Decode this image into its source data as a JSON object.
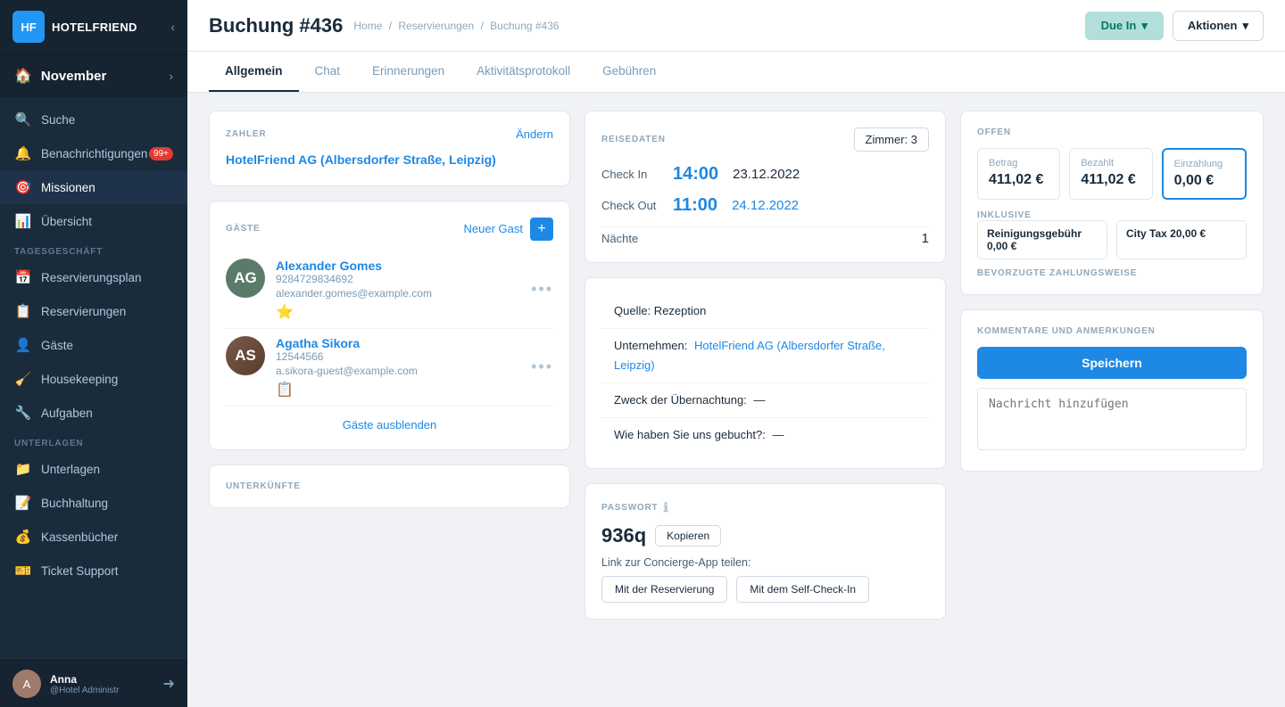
{
  "sidebar": {
    "logo_text": "HOTELFRIEND",
    "month": "November",
    "nav_items": [
      {
        "id": "suche",
        "label": "Suche",
        "icon": "🔍"
      },
      {
        "id": "benachrichtigungen",
        "label": "Benachrichtigungen",
        "icon": "🔔",
        "badge": "99+"
      },
      {
        "id": "missionen",
        "label": "Missionen",
        "icon": "🎯",
        "active": true
      }
    ],
    "nav_overview": [
      {
        "id": "ubersicht",
        "label": "Übersicht",
        "icon": "📊"
      }
    ],
    "section_tagesgeschaft": "TAGESGESCHÄFT",
    "nav_tages": [
      {
        "id": "reservierungsplan",
        "label": "Reservierungsplan",
        "icon": "📅"
      },
      {
        "id": "reservierungen",
        "label": "Reservierungen",
        "icon": "📋"
      },
      {
        "id": "gaste",
        "label": "Gäste",
        "icon": "👤"
      },
      {
        "id": "housekeeping",
        "label": "Housekeeping",
        "icon": "🧹"
      },
      {
        "id": "aufgaben",
        "label": "Aufgaben",
        "icon": "🔧"
      }
    ],
    "section_unterlagen": "UNTERLAGEN",
    "nav_unterlagen": [
      {
        "id": "unterlagen",
        "label": "Unterlagen",
        "icon": "📁"
      },
      {
        "id": "buchhaltung",
        "label": "Buchhaltung",
        "icon": "📝"
      },
      {
        "id": "kassenbuecher",
        "label": "Kassenbücher",
        "icon": "💰"
      },
      {
        "id": "ticket_support",
        "label": "Ticket Support",
        "icon": "🎫"
      }
    ],
    "user": {
      "name": "Anna",
      "role": "@Hotel Administr"
    }
  },
  "header": {
    "title": "Buchung #436",
    "breadcrumb": {
      "home": "Home",
      "reservierungen": "Reservierungen",
      "current": "Buchung #436"
    },
    "btn_due_in": "Due In",
    "btn_aktionen": "Aktionen"
  },
  "tabs": [
    {
      "id": "allgemein",
      "label": "Allgemein",
      "active": true
    },
    {
      "id": "chat",
      "label": "Chat"
    },
    {
      "id": "erinnerungen",
      "label": "Erinnerungen"
    },
    {
      "id": "aktivitatsprotokoll",
      "label": "Aktivitätsprotokoll"
    },
    {
      "id": "gebuhren",
      "label": "Gebühren"
    }
  ],
  "zahler": {
    "label": "ZAHLER",
    "btn_andern": "Ändern",
    "name": "HotelFriend AG (Albersdorfer Straße, Leipzig)"
  },
  "gaeste": {
    "label": "GÄSTE",
    "btn_neuer_gast": "Neuer Gast",
    "guests": [
      {
        "name": "Alexander Gomes",
        "phone": "9284729834692",
        "email": "alexander.gomes@example.com",
        "badge": "⭐"
      },
      {
        "name": "Agatha Sikora",
        "phone": "12544566",
        "email": "a.sikora-guest@example.com",
        "badge": "📋"
      }
    ],
    "btn_ausblenden": "Gäste ausblenden"
  },
  "unterkunfte": {
    "label": "UNTERKÜNFTE"
  },
  "reisedaten": {
    "label": "REISEDATEN",
    "btn_zimmer": "Zimmer: 3",
    "check_in_label": "Check In",
    "check_in_time": "14:00",
    "check_in_date": "23.12.2022",
    "check_out_label": "Check Out",
    "check_out_time": "11:00",
    "check_out_date": "24.12.2022",
    "nachte_label": "Nächte",
    "nachte_val": "1"
  },
  "reise_info": {
    "quelle": "Quelle: Rezeption",
    "unternehmen_prefix": "Unternehmen:",
    "unternehmen_link": "HotelFriend AG (Albersdorfer Straße, Leipzig)",
    "zweck_label": "Zweck der Übernachtung:",
    "zweck_val": "—",
    "buchung_label": "Wie haben Sie uns gebucht?:",
    "buchung_val": "—"
  },
  "passwort": {
    "label": "PASSWORT",
    "value": "936q",
    "btn_kopieren": "Kopieren",
    "link_label": "Link zur Concierge-App teilen:",
    "btn_reservierung": "Mit der Reservierung",
    "btn_self_checkin": "Mit dem Self-Check-In"
  },
  "offen": {
    "label": "OFFEN",
    "amounts": [
      {
        "title": "Betrag",
        "value": "411,02 €"
      },
      {
        "title": "Bezahlt",
        "value": "411,02 €"
      },
      {
        "title": "Einzahlung",
        "value": "0,00 €",
        "highlighted": true
      }
    ],
    "inklusive_label": "Inklusive",
    "inkl_items": [
      {
        "label": "Reinigungsgebühr",
        "value": "0,00 €"
      },
      {
        "label": "City Tax",
        "value": "20,00 €"
      }
    ],
    "bevorzugt_label": "BEVORZUGTE ZAHLUNGSWEISE"
  },
  "kommentar": {
    "label": "KOMMENTARE UND ANMERKUNGEN",
    "btn_speichern": "Speichern",
    "placeholder": "Nachricht hinzufügen"
  }
}
